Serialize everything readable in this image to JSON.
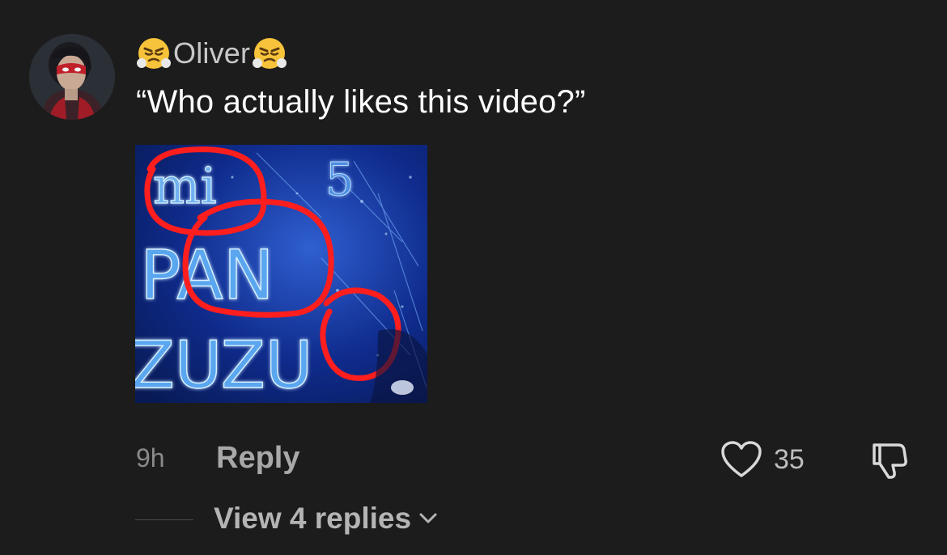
{
  "comment": {
    "username": "Oliver",
    "username_prefix_emoji": "😤",
    "username_suffix_emoji": "😤",
    "text": "“Who actually likes this video?”",
    "avatar_icon": "masked-hero-avatar",
    "attachment": {
      "kind": "image",
      "visible_text": [
        "mi",
        "5",
        "PAN",
        "ZUZU"
      ],
      "annotation_color": "#ff1e1e",
      "background_color": "#0b2a8a"
    },
    "timestamp": "9h",
    "reply_label": "Reply",
    "like_count": "35",
    "view_replies_label": "View 4 replies"
  },
  "colors": {
    "background": "#1c1c1c",
    "text_primary": "#ffffff",
    "text_secondary": "#a8a8a8",
    "icon": "#d9d9d9"
  }
}
